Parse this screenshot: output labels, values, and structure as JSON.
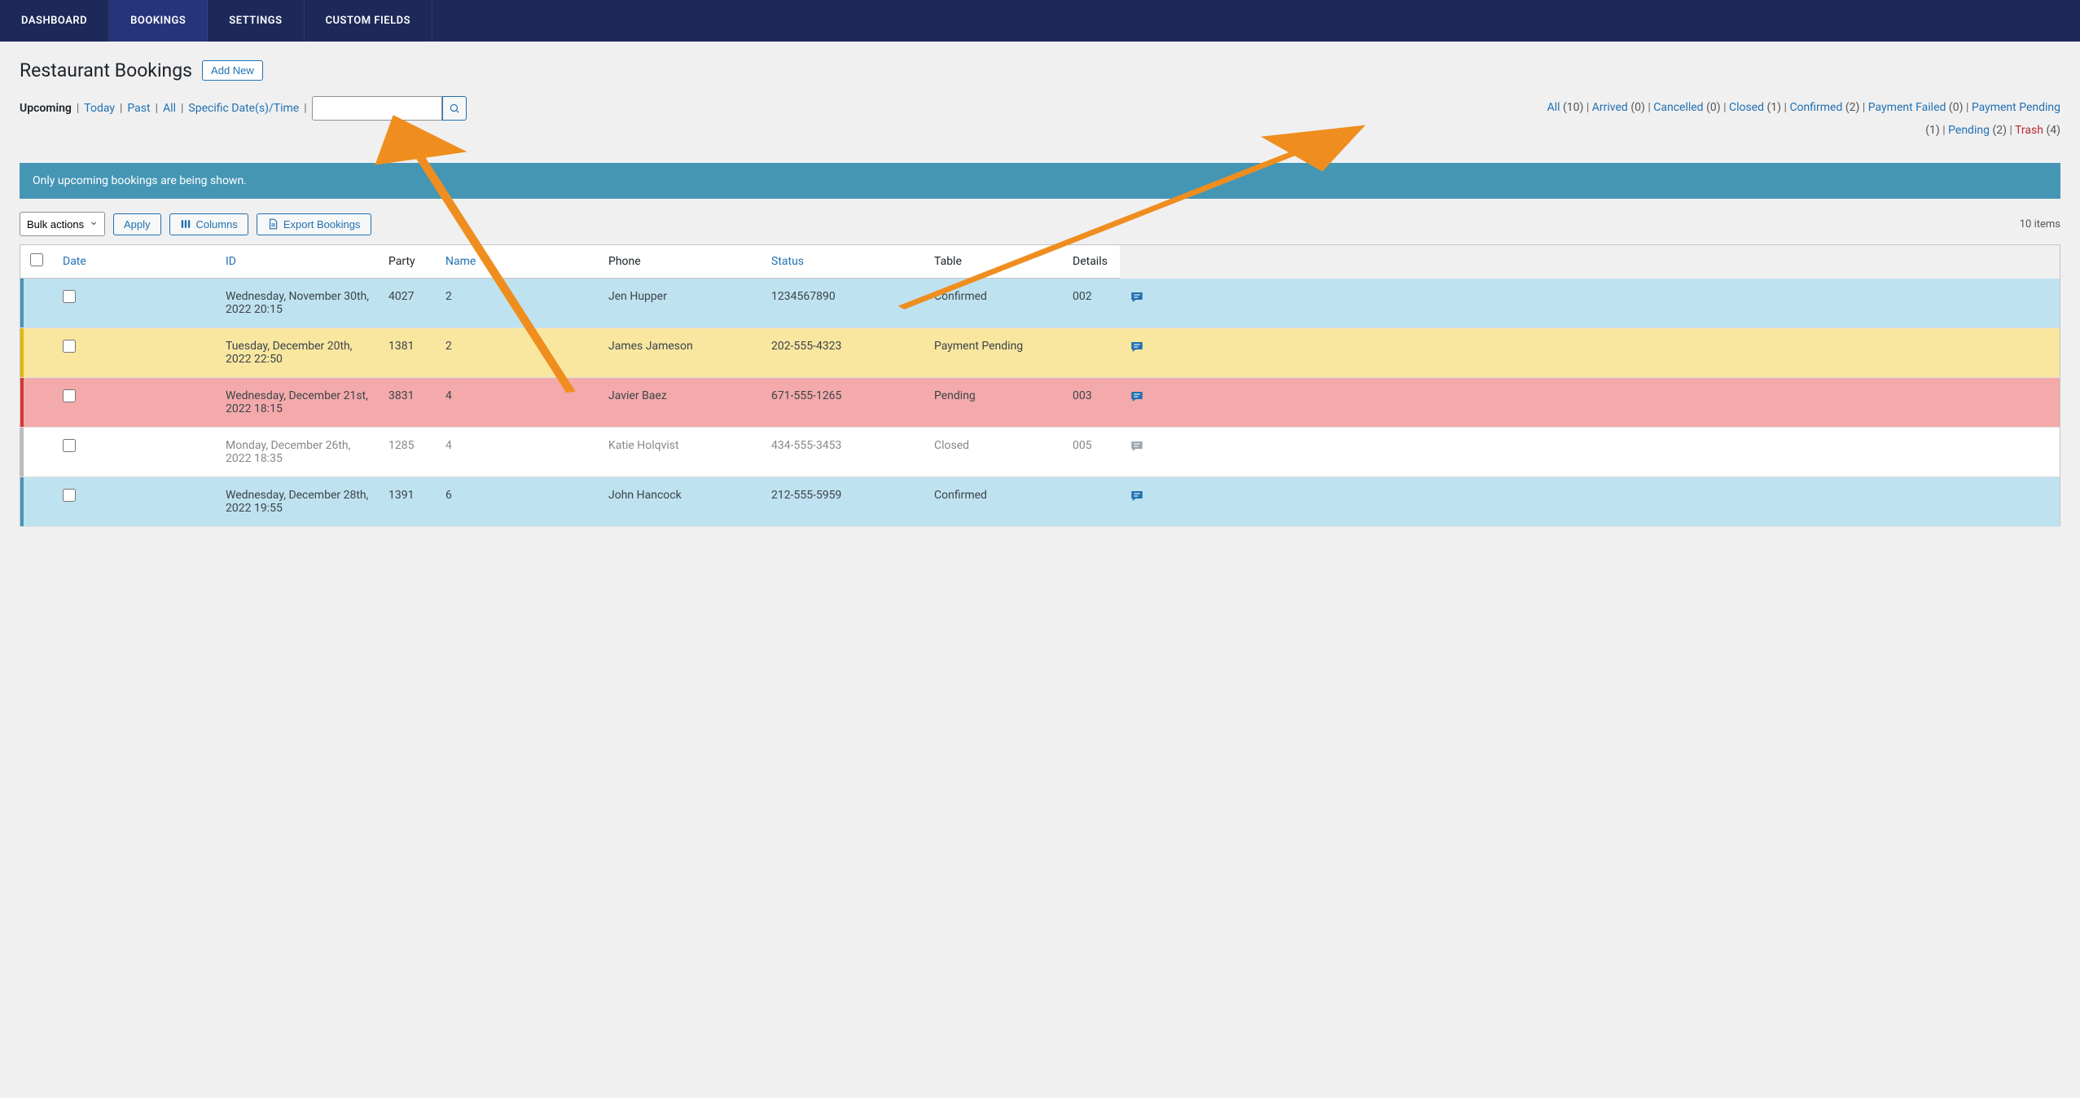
{
  "nav": {
    "dashboard": "DASHBOARD",
    "bookings": "BOOKINGS",
    "settings": "SETTINGS",
    "custom_fields": "CUSTOM FIELDS"
  },
  "page": {
    "title": "Restaurant Bookings",
    "add_new": "Add New"
  },
  "date_filters": {
    "upcoming": "Upcoming",
    "today": "Today",
    "past": "Past",
    "all": "All",
    "specific": "Specific Date(s)/Time"
  },
  "status_filters": {
    "all": {
      "label": "All",
      "count": "(10)"
    },
    "arrived": {
      "label": "Arrived",
      "count": "(0)"
    },
    "cancelled": {
      "label": "Cancelled",
      "count": "(0)"
    },
    "closed": {
      "label": "Closed",
      "count": "(1)"
    },
    "confirmed": {
      "label": "Confirmed",
      "count": "(2)"
    },
    "payment_failed": {
      "label": "Payment Failed",
      "count": "(0)"
    },
    "payment_pending": {
      "label": "Payment Pending",
      "count": "(1)"
    },
    "pending": {
      "label": "Pending",
      "count": "(2)"
    },
    "trash": {
      "label": "Trash",
      "count": "(4)"
    }
  },
  "notice": "Only upcoming bookings are being shown.",
  "actions": {
    "bulk": "Bulk actions",
    "apply": "Apply",
    "columns": "Columns",
    "export": "Export Bookings",
    "items_count": "10 items"
  },
  "columns": {
    "date": "Date",
    "id": "ID",
    "party": "Party",
    "name": "Name",
    "phone": "Phone",
    "status": "Status",
    "table": "Table",
    "details": "Details"
  },
  "rows": [
    {
      "date": "Wednesday, November 30th, 2022 20:15",
      "id": "4027",
      "party": "2",
      "name": "Jen Hupper",
      "phone": "1234567890",
      "status": "Confirmed",
      "table": "002",
      "css": "status-confirmed"
    },
    {
      "date": "Tuesday, December 20th, 2022 22:50",
      "id": "1381",
      "party": "2",
      "name": "James Jameson",
      "phone": "202-555-4323",
      "status": "Payment Pending",
      "table": "",
      "css": "status-payment-pending"
    },
    {
      "date": "Wednesday, December 21st, 2022 18:15",
      "id": "3831",
      "party": "4",
      "name": "Javier Baez",
      "phone": "671-555-1265",
      "status": "Pending",
      "table": "003",
      "css": "status-pending"
    },
    {
      "date": "Monday, December 26th, 2022 18:35",
      "id": "1285",
      "party": "4",
      "name": "Katie Holqvist",
      "phone": "434-555-3453",
      "status": "Closed",
      "table": "005",
      "css": "status-closed"
    },
    {
      "date": "Wednesday, December 28th, 2022 19:55",
      "id": "1391",
      "party": "6",
      "name": "John Hancock",
      "phone": "212-555-5959",
      "status": "Confirmed",
      "table": "",
      "css": "status-confirmed"
    }
  ]
}
